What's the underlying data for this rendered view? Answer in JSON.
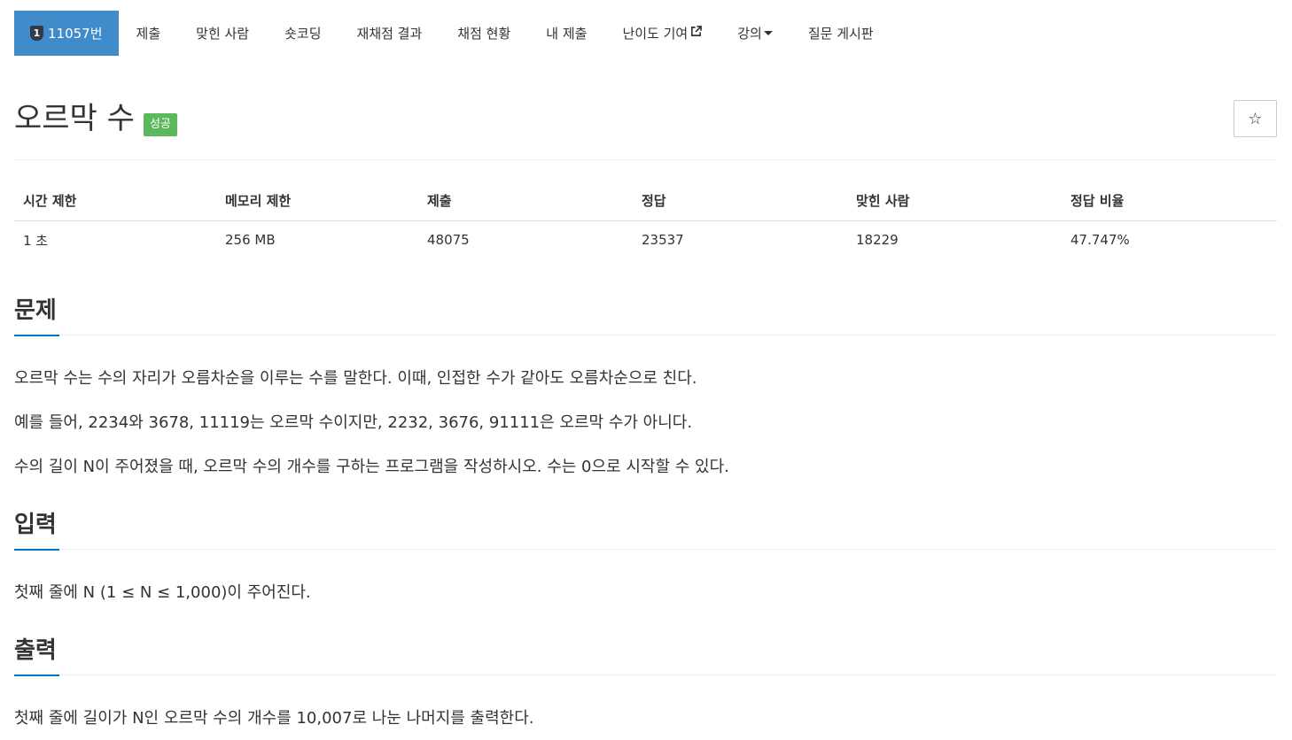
{
  "nav": {
    "problem_no": "11057번",
    "tier_badge": "1",
    "items": [
      "제출",
      "맞힌 사람",
      "숏코딩",
      "재채점 결과",
      "채점 현황",
      "내 제출",
      "난이도 기여",
      "강의",
      "질문 게시판"
    ],
    "icons": {
      "external": "external-link-icon",
      "dropdown": "caret-down-icon",
      "tier": "tier-badge-icon"
    }
  },
  "title": "오르막 수",
  "status_badge": "성공",
  "star_icon": "☆",
  "info_table": {
    "headers": [
      "시간 제한",
      "메모리 제한",
      "제출",
      "정답",
      "맞힌 사람",
      "정답 비율"
    ],
    "values": [
      "1 초",
      "256 MB",
      "48075",
      "23537",
      "18229",
      "47.747%"
    ]
  },
  "sections": {
    "problem": {
      "title": "문제",
      "paragraphs": [
        "오르막 수는 수의 자리가 오름차순을 이루는 수를 말한다. 이때, 인접한 수가 같아도 오름차순으로 친다.",
        "예를 들어, 2234와 3678, 11119는 오르막 수이지만, 2232, 3676, 91111은 오르막 수가 아니다.",
        "수의 길이 N이 주어졌을 때, 오르막 수의 개수를 구하는 프로그램을 작성하시오. 수는 0으로 시작할 수 있다."
      ]
    },
    "input": {
      "title": "입력",
      "paragraphs": [
        "첫째 줄에 N (1 ≤ N ≤ 1,000)이 주어진다."
      ]
    },
    "output": {
      "title": "출력",
      "paragraphs": [
        "첫째 줄에 길이가 N인 오르막 수의 개수를 10,007로 나눈 나머지를 출력한다."
      ]
    }
  },
  "colors": {
    "primary": "#428bca",
    "success": "#5cb85c",
    "accent_underline": "#0076c0"
  }
}
